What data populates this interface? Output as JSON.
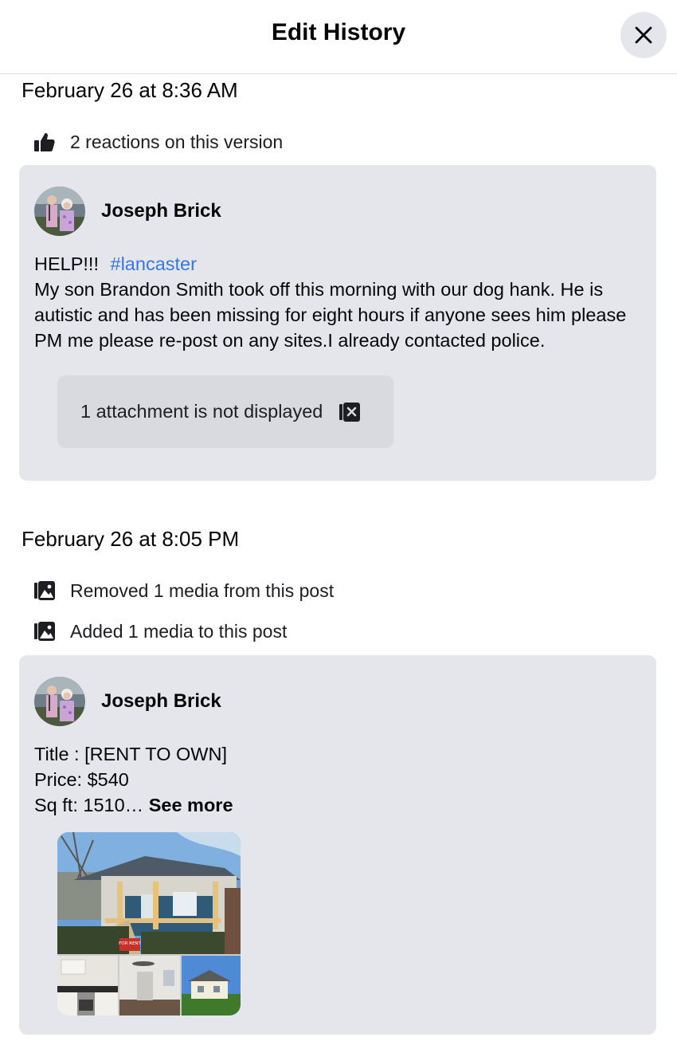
{
  "header": {
    "title": "Edit History",
    "close_icon": "close-icon"
  },
  "versions": [
    {
      "timestamp": "February 26 at 8:36 AM",
      "changes": [
        {
          "icon": "thumbs-up-icon",
          "text": "2 reactions on this version"
        }
      ],
      "post": {
        "author": "Joseph Brick",
        "line1": "HELP!!!",
        "hashtag": "#lancaster",
        "body": "My son Brandon Smith took off this morning with our dog hank. He is autistic and has been missing for eight hours if anyone sees him please PM me please re-post on any sites.I already contacted police.",
        "attachment_notice": "1 attachment is not displayed",
        "attachment_icon": "hidden-media-icon"
      }
    },
    {
      "timestamp": "February 26 at 8:05 PM",
      "changes": [
        {
          "icon": "media-icon",
          "text": "Removed 1 media from this post"
        },
        {
          "icon": "media-icon",
          "text": "Added 1 media to this post"
        }
      ],
      "post": {
        "author": "Joseph Brick",
        "lines": [
          "Title : [RENT TO OWN]",
          "Price: $540",
          "Sq ft: 1510…"
        ],
        "see_more": "See more",
        "sign_text": "FOR RENT"
      }
    }
  ],
  "colors": {
    "hashtag": "#3578e5",
    "card_bg": "#e4e6eb",
    "attach_bg": "#d8dadf"
  }
}
